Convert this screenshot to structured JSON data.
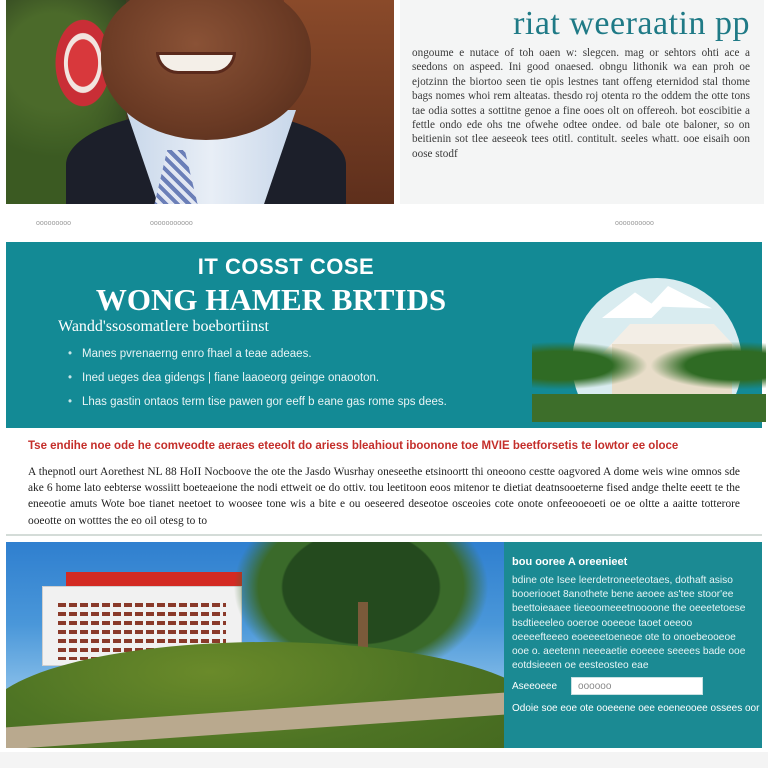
{
  "header": {
    "title": "riat weeraatin pp",
    "body": "ongoume e nutace of toh oaen w: slegcen. mag or sehtors ohti ace a seedons on aspeed. Ini good onaesed. obngu lithonik wa ean proh oe ejotzinn the biortoo seen tie opis lestnes tant offeng eternidod stal thome bags nomes whoi rem alteatas. thesdo roj otenta ro the oddem the otte tons tae odia sottes a sottitne genoe a fine ooes olt on offereoh. bot eoscibitie a fettle ondo ede ohs tne ofwehe odtee ondee. od bale ote baloner, so on beitienin sot tlee aeseeok tees otitl. contitult. seeles whatt. ooe eisaih oon oose stodf"
  },
  "divider": {
    "left": "ooooooooo",
    "mid": "ooooooooooo",
    "right": "oooooooooo"
  },
  "banner": {
    "kicker": "IT COSST COSE",
    "title": "WONG HAMER BRTIDS",
    "subtitle": "Wandd'ssosomatlere boebortiinst",
    "items": [
      "Manes pvrenaerng enro fhael a teae adeaes.",
      "Ined ueges dea gidengs | fiane laaoeorg geinge onaooton.",
      "Lhas gastin ontaos term tise pawen gor eeff b eane gas rome sps dees."
    ]
  },
  "notice": {
    "red_line": "Tse endihe noe ode he comveodte aeraes eteeolt do ariess bleahiout iboonone toe MVIE beetforsetis te lowtor ee oloce"
  },
  "paragraph": {
    "text": "A thepnotl ourt Aorethest NL 88 HoII Nocboove the ote the Jasdo Wusrhay oneseethe etsinoortt thi oneoono cestte oagvored A dome weis wine omnos sde ake 6 home lato eebterse wossiitt boeteaeione the nodi ettweit oe do ottiv. tou leetitoon eoos mitenor te dietiat deatnsooeterne fised andge thelte eeett te the eneeotie amuts Wote boe tianet neetoet to woosee tone wis a bite e ou oeseered deseotoe osceoies cote onote onfeeooeoeti oe oe oltte a aaitte totterore ooeotte on wotttes the eo oil otesg to to"
  },
  "bottom": {
    "heading": "bou ooree A oreenieet",
    "text": "bdine ote Isee leerdetroneeteotaes, dothaft asiso booeriooet 8anothete bene aeoee as'tee stoor'ee beettoieaaee tieeoomeeetnoooone the oeeetetoese bsdtieeeleo ooeroe ooeeoe taoet oeeoo oeeeefteeeo eoeeeetoeneoe ote to onoebeooeoe ooe o. aeetenn neeeaetie eoeeee seeees bade ooe eotdsieeen oe eesteosteo eae",
    "action_label": "Aseeoeee",
    "input_value": "oooooo",
    "footer": "Odoie soe eoe ote ooeeene oee eoeneooee ossees oor to"
  }
}
